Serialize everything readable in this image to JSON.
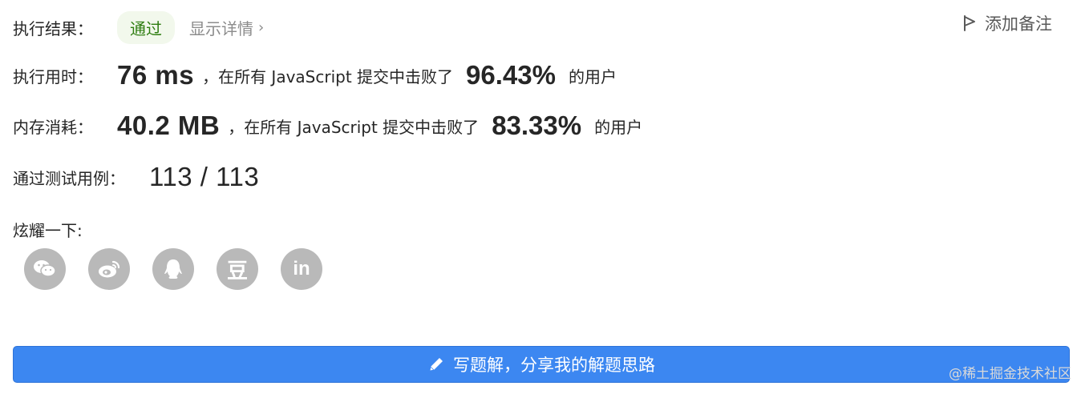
{
  "result": {
    "label": "执行结果：",
    "status": "通过",
    "detail_link": "显示详情",
    "note_button": "添加备注"
  },
  "runtime": {
    "label": "执行用时：",
    "value": "76 ms",
    "middle_text": "，在所有 JavaScript 提交中击败了",
    "percent": "96.43%",
    "suffix": "的用户"
  },
  "memory": {
    "label": "内存消耗：",
    "value": "40.2 MB",
    "middle_text": "，在所有 JavaScript 提交中击败了",
    "percent": "83.33%",
    "suffix": "的用户"
  },
  "tests": {
    "label": "通过测试用例：",
    "value": "113 / 113"
  },
  "share": {
    "label": "炫耀一下:",
    "icons": [
      "wechat-icon",
      "weibo-icon",
      "qq-icon",
      "douban-icon",
      "linkedin-icon"
    ],
    "douban_glyph": "豆",
    "linkedin_glyph": "in"
  },
  "solution_button": {
    "label": "写题解，分享我的解题思路"
  },
  "watermark": "@稀土掘金技术社区",
  "colors": {
    "accent_blue": "#3c87f1",
    "status_green": "#2e7d10",
    "status_bg": "#f2f8ec",
    "icon_grey": "#b9b9b9"
  }
}
